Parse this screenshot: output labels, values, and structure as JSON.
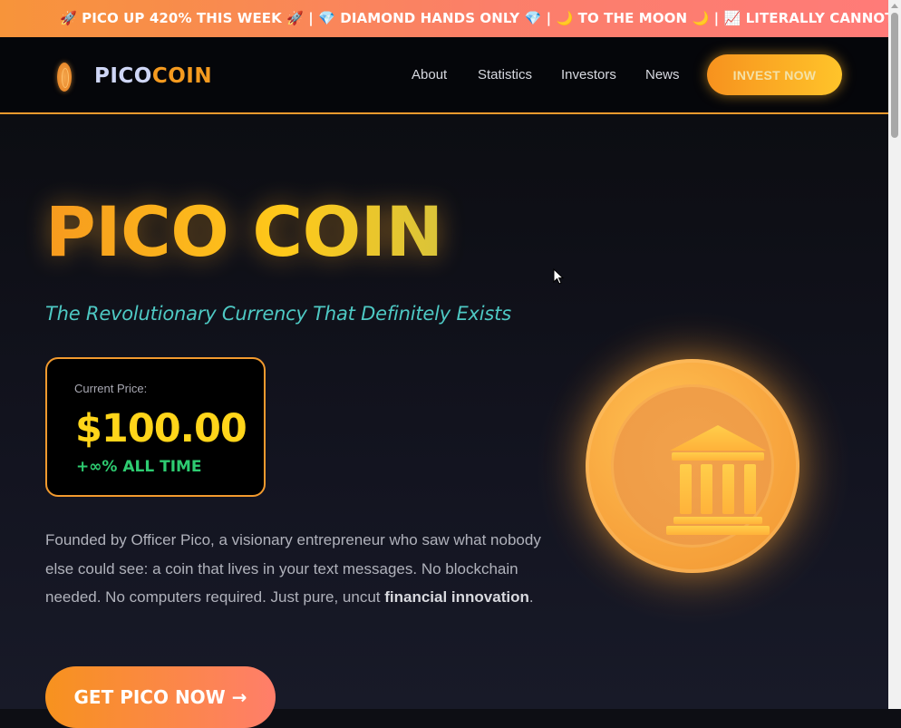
{
  "ticker": {
    "text": "🚀 PICO UP 420% THIS WEEK 🚀 | 💎 DIAMOND HANDS ONLY 💎 | 🌙 TO THE MOON 🌙 | 📈 LITERALLY CANNOT GO D"
  },
  "nav": {
    "logo_part1": "PICO",
    "logo_part2": "COIN",
    "links": [
      "About",
      "Statistics",
      "Investors",
      "News"
    ],
    "cta": "INVEST NOW"
  },
  "hero": {
    "title": "PICO COIN",
    "tagline": "The Revolutionary Currency That Definitely Exists",
    "price_label": "Current Price:",
    "price_value": "$100.00",
    "price_change": "+∞% ALL TIME",
    "desc_text": "Founded by Officer Pico, a visionary entrepreneur who saw what nobody else could see: a coin that lives in your text messages. No blockchain needed. No computers required. Just pure, uncut ",
    "desc_bold": "financial innovation",
    "desc_end": ".",
    "cta": "GET PICO NOW →"
  },
  "icons": {
    "logo": "coin-icon",
    "coin_emblem": "bank-icon"
  },
  "colors": {
    "accent_orange": "#f79a1e",
    "accent_gold": "#ffd51a",
    "tagline_teal": "#4ec9c4",
    "positive_green": "#2ecc71"
  }
}
